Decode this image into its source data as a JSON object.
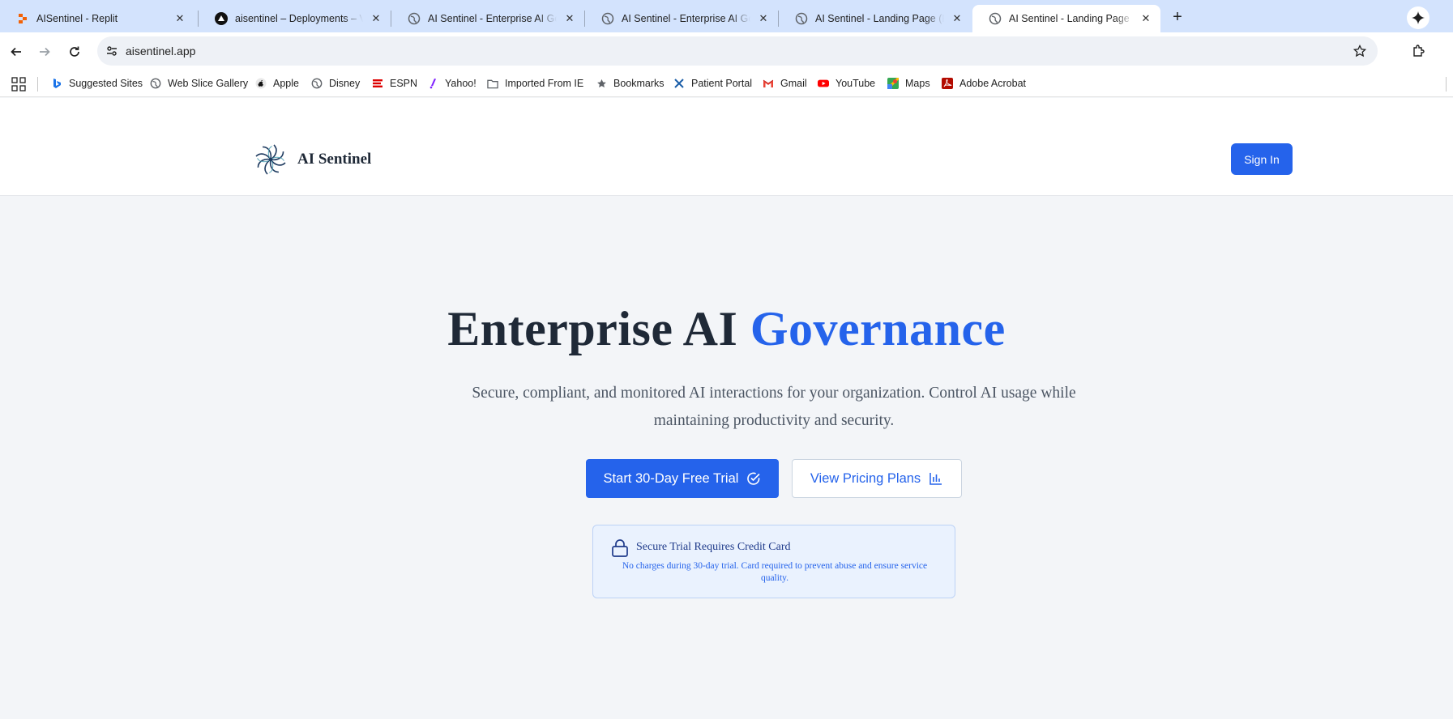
{
  "browser": {
    "tabs": [
      {
        "title": "AISentinel - Replit",
        "icon": "replit-icon",
        "active": false
      },
      {
        "title": "aisentinel – Deployments – Vercel",
        "icon": "vercel-icon",
        "active": false
      },
      {
        "title": "AI Sentinel - Enterprise AI Governance",
        "icon": "globe-icon",
        "active": false
      },
      {
        "title": "AI Sentinel - Enterprise AI Governance",
        "icon": "globe-icon",
        "active": false
      },
      {
        "title": "AI Sentinel - Landing Page (React)",
        "icon": "globe-icon",
        "active": false
      },
      {
        "title": "AI Sentinel - Landing Page (React)",
        "icon": "globe-icon",
        "active": true
      }
    ],
    "close_glyph": "✕",
    "new_tab_glyph": "+",
    "url": "aisentinel.app",
    "bookmarks": [
      {
        "label": "Suggested Sites",
        "icon": "bing-icon"
      },
      {
        "label": "Web Slice Gallery",
        "icon": "globe-icon"
      },
      {
        "label": "Apple",
        "icon": "apple-icon"
      },
      {
        "label": "Disney",
        "icon": "globe-icon"
      },
      {
        "label": "ESPN",
        "icon": "espn-icon"
      },
      {
        "label": "Yahoo!",
        "icon": "yahoo-icon"
      },
      {
        "label": "Imported From IE",
        "icon": "folder-icon"
      },
      {
        "label": "Bookmarks",
        "icon": "star-icon"
      },
      {
        "label": "Patient Portal",
        "icon": "x-icon"
      },
      {
        "label": "Gmail",
        "icon": "gmail-icon"
      },
      {
        "label": "YouTube",
        "icon": "youtube-icon"
      },
      {
        "label": "Maps",
        "icon": "maps-icon"
      },
      {
        "label": "Adobe Acrobat",
        "icon": "acrobat-icon"
      }
    ]
  },
  "header": {
    "brand": "AI Sentinel",
    "sign_in": "Sign In"
  },
  "hero": {
    "title_main": "Enterprise AI ",
    "title_accent": "Governance",
    "subtitle": "Secure, compliant, and monitored AI interactions for your organization. Control AI usage while maintaining productivity and security.",
    "primary_cta": "Start 30-Day Free Trial",
    "secondary_cta": "View Pricing Plans"
  },
  "notice": {
    "title": "Secure Trial Requires Credit Card",
    "text": "No charges during 30-day trial. Card required to prevent abuse and ensure service quality."
  },
  "colors": {
    "accent": "#2563eb",
    "tabstrip": "#d3e3fd",
    "notice_bg": "#eaf2fe"
  }
}
